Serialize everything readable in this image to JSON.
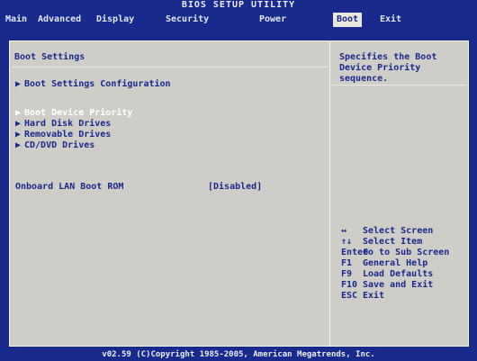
{
  "app": {
    "title": "BIOS SETUP UTILITY"
  },
  "menubar": {
    "tabs": [
      {
        "label": "Main"
      },
      {
        "label": "Advanced"
      },
      {
        "label": "Display"
      },
      {
        "label": "Security"
      },
      {
        "label": "Power"
      },
      {
        "label": "Boot"
      },
      {
        "label": "Exit"
      }
    ],
    "active": "Boot"
  },
  "boot": {
    "section_title": "Boot Settings",
    "items": [
      {
        "label": "Boot Settings Configuration"
      },
      {
        "label": "Boot Device Priority"
      },
      {
        "label": "Hard Disk Drives"
      },
      {
        "label": "Removable Drives"
      },
      {
        "label": "CD/DVD Drives"
      }
    ],
    "arrow_glyph": "▶",
    "onboard": {
      "label": "Onboard LAN Boot ROM",
      "value": "[Disabled]"
    }
  },
  "help": {
    "text": "Specifies the Boot Device Priority sequence."
  },
  "keys": [
    {
      "key": "↔",
      "desc": "Select Screen"
    },
    {
      "key": "↑↓",
      "desc": "Select Item"
    },
    {
      "key": "Enter",
      "desc": "Go to Sub Screen"
    },
    {
      "key": "F1",
      "desc": "General Help"
    },
    {
      "key": "F9",
      "desc": "Load Defaults"
    },
    {
      "key": "F10",
      "desc": "Save and Exit"
    },
    {
      "key": "ESC",
      "desc": "Exit"
    }
  ],
  "footer": {
    "text": "v02.59 (C)Copyright 1985-2005, American Megatrends, Inc."
  },
  "colors": {
    "background": "#1a2a8c",
    "panel": "#cfcdc7",
    "text_blue": "#1a2a8c",
    "selected_text": "#ffffff"
  }
}
